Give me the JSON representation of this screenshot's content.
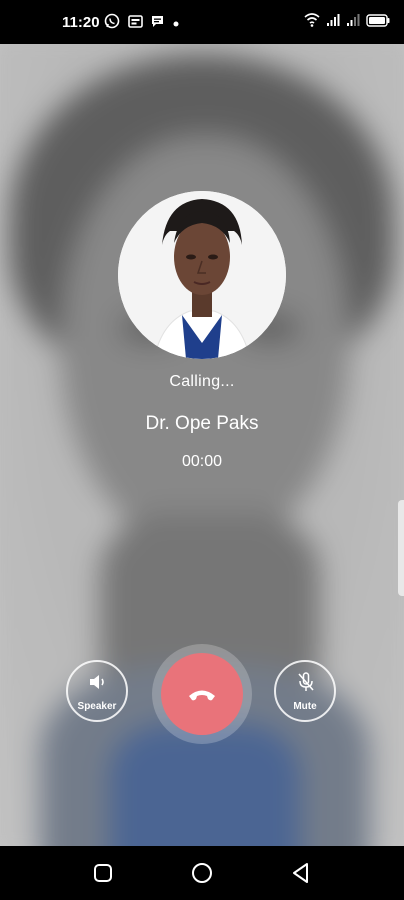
{
  "status_bar": {
    "time": "11:20",
    "left_icons": [
      "whatsapp-icon",
      "notification-card-icon",
      "chat-icon",
      "dot-icon"
    ],
    "right_icons": [
      "wifi-icon",
      "signal-icon",
      "signal-icon",
      "battery-icon"
    ]
  },
  "call": {
    "status_text": "Calling...",
    "callee_name": "Dr. Ope Paks",
    "timer": "00:00"
  },
  "controls": {
    "speaker_label": "Speaker",
    "mute_label": "Mute",
    "end_call_icon": "hang-up-phone-icon"
  },
  "colors": {
    "end_call_red": "#e9737a",
    "doctor_scrubs_blue": "#1f3f8c"
  },
  "nav_bar": {
    "buttons": [
      "recent-apps-icon",
      "home-icon",
      "back-icon"
    ]
  }
}
